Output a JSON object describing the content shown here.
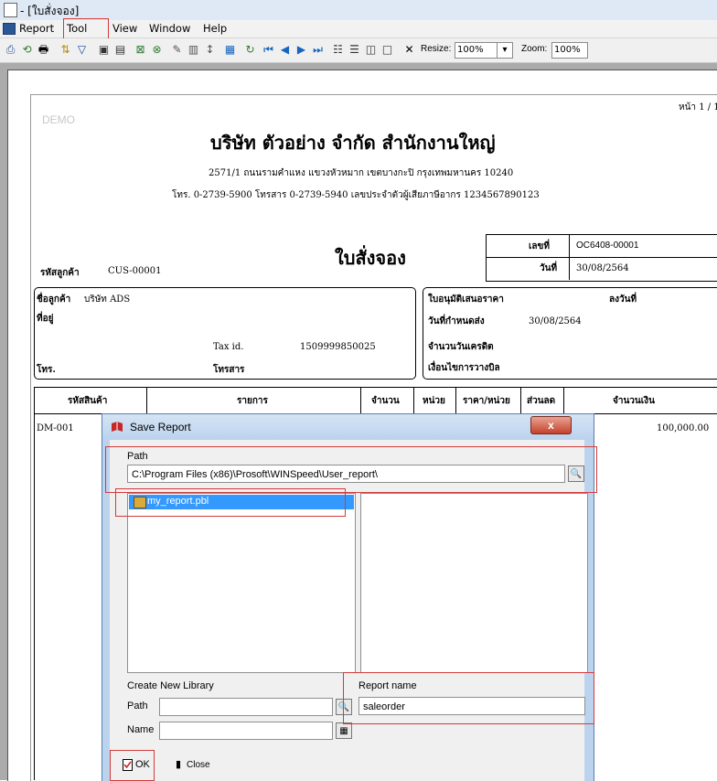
{
  "window": {
    "title": "- [ใบสั่งจอง]"
  },
  "menu": [
    "Report",
    "Tool",
    "View",
    "Window",
    "Help"
  ],
  "toolbar": {
    "resize_label": "Resize:",
    "resize_value": "100%",
    "zoom_label": "Zoom:",
    "zoom_value": "100%"
  },
  "report": {
    "demo": "DEMO",
    "page": "หน้า 1 / 1",
    "company": "บริษัท ตัวอย่าง จำกัด   สำนักงานใหญ่",
    "address": "2571/1 ถนนรามคำแหง แขวงหัวหมาก เขตบางกะปิ กรุงเทพมหานคร 10240",
    "contact": "โทร. 0-2739-5900  โทรสาร 0-2739-5940  เลขประจำตัวผู้เสียภาษีอากร 1234567890123",
    "doc_title": "ใบสั่งจอง",
    "doc_no_label": "เลขที่",
    "doc_no": "OC6408-00001",
    "date_label": "วันที่",
    "date": "30/08/2564",
    "cust_code_label": "รหัสลูกค้า",
    "cust_code": "CUS-00001",
    "cust_name_label": "ชื่อลูกค้า",
    "cust_name": "บริษัท ADS",
    "address_label": "ที่อยู่",
    "tax_label": "Tax id.",
    "tax_id": "1509999850025",
    "tel_label": "โทร.",
    "fax_label": "โทรสาร",
    "quote_label": "ใบอนุมัติเสนอราคา",
    "quote_date_label": "ลงวันที่",
    "ship_date_label": "วันที่กำหนดส่ง",
    "ship_date": "30/08/2564",
    "credit_label": "จำนวนวันเครดิต",
    "billing_label": "เงื่อนไขการวางบิล",
    "columns": [
      "รหัสสินค้า",
      "รายการ",
      "จำนวน",
      "หน่วย",
      "ราคา/หน่วย",
      "ส่วนลด",
      "จำนวนเงิน"
    ],
    "row": {
      "code": "DM-001",
      "amount": "100,000.00"
    }
  },
  "dialog": {
    "title": "Save Report",
    "path_label": "Path",
    "path_value": "C:\\Program Files (x86)\\Prosoft\\WINSpeed\\User_report\\",
    "library_item": "my_report.pbl",
    "create_group": "Create New Library",
    "new_path_label": "Path",
    "new_name_label": "Name",
    "report_name_label": "Report name",
    "report_name_value": "saleorder",
    "ok_label": "OK",
    "close_label": "Close"
  }
}
